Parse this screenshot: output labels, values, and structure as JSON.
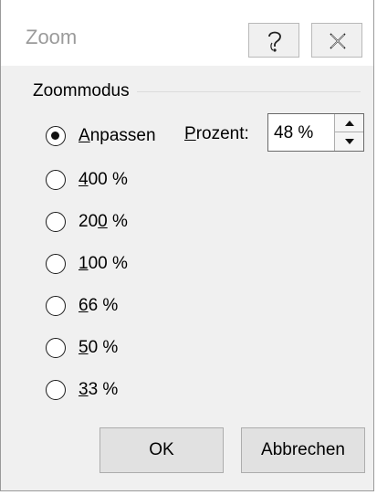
{
  "window": {
    "title": "Zoom"
  },
  "titlebar": {
    "help_icon": "help-icon",
    "close_icon": "close-icon"
  },
  "zoom_group": {
    "label": "Zoommodus",
    "options": [
      {
        "label_pre": "",
        "label_ul": "A",
        "label_post": "npassen",
        "checked": true
      },
      {
        "label_pre": "",
        "label_ul": "4",
        "label_post": "00 %",
        "checked": false
      },
      {
        "label_pre": "20",
        "label_ul": "0",
        "label_post": " %",
        "checked": false
      },
      {
        "label_pre": "",
        "label_ul": "1",
        "label_post": "00 %",
        "checked": false
      },
      {
        "label_pre": "",
        "label_ul": "6",
        "label_post": "6 %",
        "checked": false
      },
      {
        "label_pre": "",
        "label_ul": "5",
        "label_post": "0 %",
        "checked": false
      },
      {
        "label_pre": "",
        "label_ul": "3",
        "label_post": "3 %",
        "checked": false
      }
    ]
  },
  "percent": {
    "label_ul": "P",
    "label_rest": "rozent:",
    "value": "48 %"
  },
  "buttons": {
    "ok": "OK",
    "cancel": "Abbrechen"
  },
  "colors": {
    "dialog_bg": "#f0f0f0",
    "title_text": "#9b9b9b",
    "button_bg": "#e1e1e1"
  }
}
